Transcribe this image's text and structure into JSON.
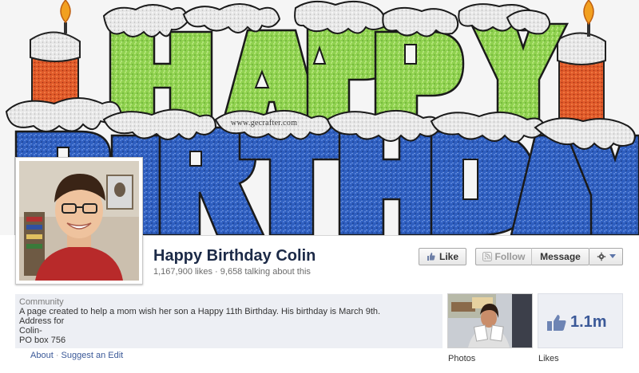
{
  "cover": {
    "watermark": "www.gecrafter.com"
  },
  "page": {
    "name": "Happy Birthday Colin",
    "stats": "1,167,900 likes · 9,658 talking about this"
  },
  "actions": {
    "like_label": "Like",
    "follow_label": "Follow",
    "message_label": "Message"
  },
  "about": {
    "category": "Community",
    "description": "A page created to help a mom wish her son a Happy 11th Birthday. His birthday is March 9th.",
    "address_label": "Address for",
    "address_line": "Colin-",
    "address_partial": "PO box 756",
    "about_link": "About",
    "separator": "·",
    "suggest_link": "Suggest an Edit"
  },
  "tiles": {
    "photos_label": "Photos",
    "likes_label": "Likes",
    "likes_count": "1.1m"
  },
  "colors": {
    "brand_blue": "#3b5998",
    "name_color": "#1c2a47",
    "panel_bg": "#edeff4"
  }
}
